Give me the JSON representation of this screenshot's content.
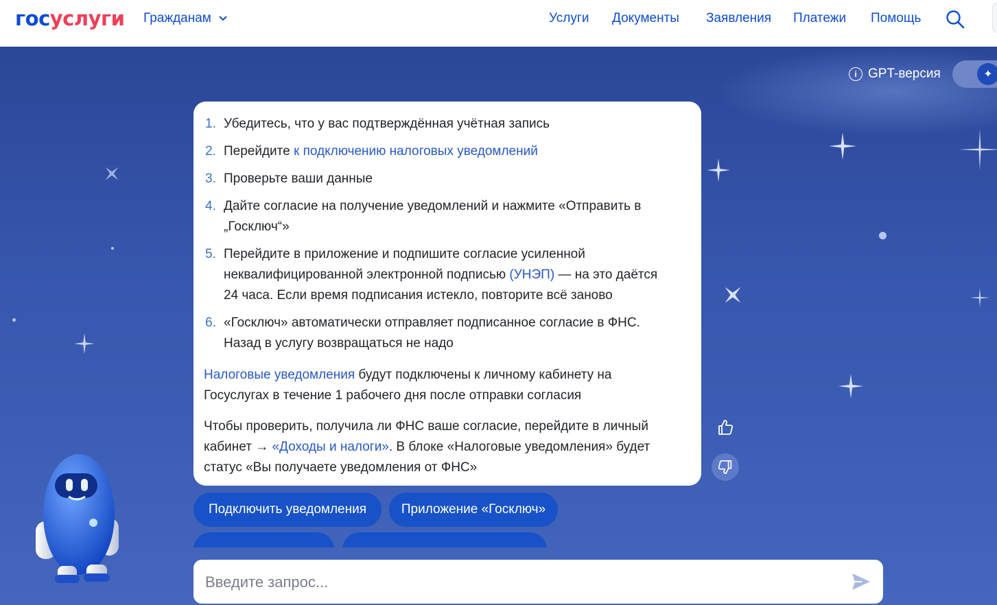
{
  "header": {
    "logo_part1": "гос",
    "logo_part2": "услуги",
    "audience_label": "Гражданам",
    "nav": [
      "Услуги",
      "Документы",
      "Заявления",
      "Платежи",
      "Помощь"
    ]
  },
  "gpt": {
    "label": "GPT-версия",
    "enabled": true
  },
  "answer": {
    "steps": [
      {
        "num": "1.",
        "text": "Убедитесь, что у вас подтверждённая учётная запись"
      },
      {
        "num": "2.",
        "before": "Перейдите ",
        "link": "к подключению налоговых уведомлений"
      },
      {
        "num": "3.",
        "text": "Проверьте ваши данные"
      },
      {
        "num": "4.",
        "line1": "Дайте согласие на получение уведомлений и нажмите «Отправить в",
        "line2": "„Госключ“»"
      },
      {
        "num": "5.",
        "line1": "Перейдите в приложение и подпишите согласие усиленной",
        "line2_before": "неквалифицированной электронной подписью ",
        "line2_link": "(УНЭП)",
        "line2_after": " — на это даётся",
        "line3": "24 часа. Если время подписания истекло, повторите всё заново"
      },
      {
        "num": "6.",
        "line1": "«Госключ» автоматически отправляет подписанное согласие в ФНС.",
        "line2": "Назад в услугу возвращаться не надо"
      }
    ],
    "para1": {
      "link": "Налоговые уведомления",
      "line1_after": " будут подключены к личному кабинету на",
      "line2": "Госуслугах в течение 1 рабочего дня после отправки согласия"
    },
    "para2": {
      "line1": "Чтобы проверить, получила ли ФНС ваше согласие, перейдите в личный",
      "line2_before": "кабинет → ",
      "line2_link": "«Доходы и налоги»",
      "line2_after": ". В блоке «Налоговые уведомления» будет",
      "line3": "статус «Вы получаете уведомления от ФНС»"
    }
  },
  "suggestions": [
    "Подключить уведомления",
    "Приложение «Госключ»"
  ],
  "input": {
    "placeholder": "Введите запрос..."
  },
  "icons": {
    "search": "search-icon",
    "send": "send-icon",
    "like": "thumbs-up-icon",
    "dislike": "thumbs-down-icon"
  },
  "colors": {
    "brand_blue": "#0d4cd3",
    "brand_red": "#ee3f58",
    "button_blue": "#1752c8",
    "background": "#3756ad"
  }
}
